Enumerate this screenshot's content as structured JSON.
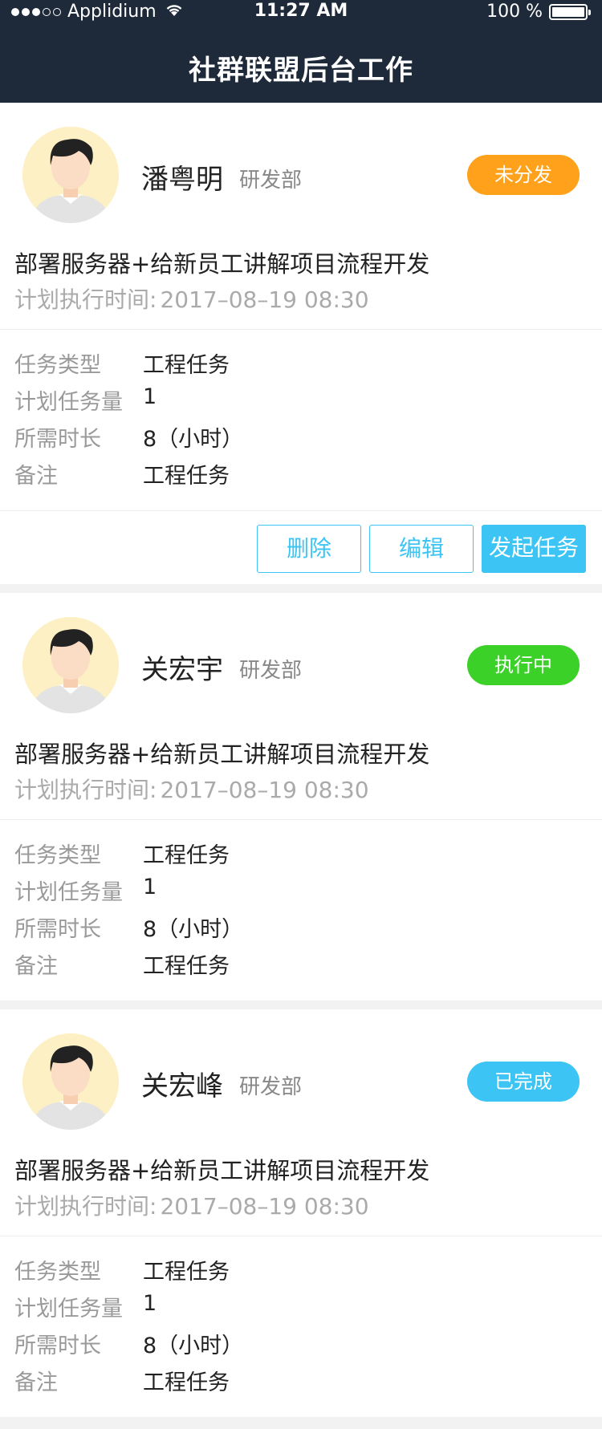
{
  "status_bar": {
    "carrier": "Applidium",
    "time": "11:27 AM",
    "battery": "100 %"
  },
  "nav": {
    "title": "社群联盟后台工作"
  },
  "labels": {
    "task_type": "任务类型",
    "planned_qty": "计划任务量",
    "duration": "所需时长",
    "note": "备注",
    "planned_time": "计划执行时间:"
  },
  "colors": {
    "header_bg": "#1e2a3a",
    "pending": "#ffa11a",
    "in_progress": "#3cd128",
    "done": "#3cc4f4",
    "accent": "#3cc4f4"
  },
  "tasks": [
    {
      "name": "潘粤明",
      "dept": "研发部",
      "status": "未分发",
      "title": "部署服务器+给新员工讲解项目流程开发",
      "time": "2017–08–19   08:30",
      "task_type": "工程任务",
      "planned_qty": "1",
      "duration": "8（小时）",
      "note": "工程任务",
      "actions": {
        "delete": "删除",
        "edit": "编辑",
        "start": "发起任务"
      }
    },
    {
      "name": "关宏宇",
      "dept": "研发部",
      "status": "执行中",
      "title": "部署服务器+给新员工讲解项目流程开发",
      "time": "2017–08–19   08:30",
      "task_type": "工程任务",
      "planned_qty": "1",
      "duration": "8（小时）",
      "note": "工程任务"
    },
    {
      "name": "关宏峰",
      "dept": "研发部",
      "status": "已完成",
      "title": "部署服务器+给新员工讲解项目流程开发",
      "time": "2017–08–19   08:30",
      "task_type": "工程任务",
      "planned_qty": "1",
      "duration": "8（小时）",
      "note": "工程任务"
    }
  ]
}
